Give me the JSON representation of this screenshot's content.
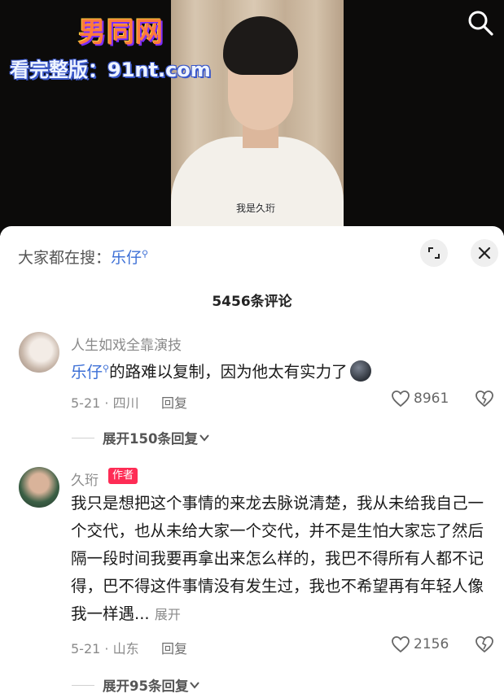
{
  "video": {
    "watermark_logo": "男同网",
    "watermark_url": "看完整版：91nt.com",
    "caption": "我是久珩"
  },
  "header": {
    "hot_search_prefix": "大家都在搜：",
    "hot_search_term": "乐仔",
    "comment_count": "5456条评论"
  },
  "comments": [
    {
      "username": "人生如戏全靠演技",
      "link_text": "乐仔",
      "text": "的路难以复制，因为他太有实力了",
      "date_location": "5-21 · 四川",
      "reply_label": "回复",
      "likes": "8961",
      "expand_label": "展开150条回复"
    },
    {
      "username": "久珩",
      "badge": "作者",
      "text": "我只是想把这个事情的来龙去脉说清楚，我从未给我自己一个交代，也从未给大家一个交代，并不是生怕大家忘了然后隔一段时间我要再拿出来怎么样的，我巴不得所有人都不记得，巴不得这件事情没有发生过，我也不希望再有年轻人像我一样遇...",
      "more_label": "展开",
      "date_location": "5-21 · 山东",
      "reply_label": "回复",
      "likes": "2156",
      "expand_label": "展开95条回复"
    }
  ],
  "icons": {
    "search": "search-icon",
    "expand": "expand-icon",
    "close": "close-icon",
    "like": "heart-icon",
    "dislike": "broken-heart-icon",
    "chevron": "chevron-down-icon"
  },
  "colors": {
    "link": "#3c6fd6",
    "author_badge": "#fe2c55"
  }
}
